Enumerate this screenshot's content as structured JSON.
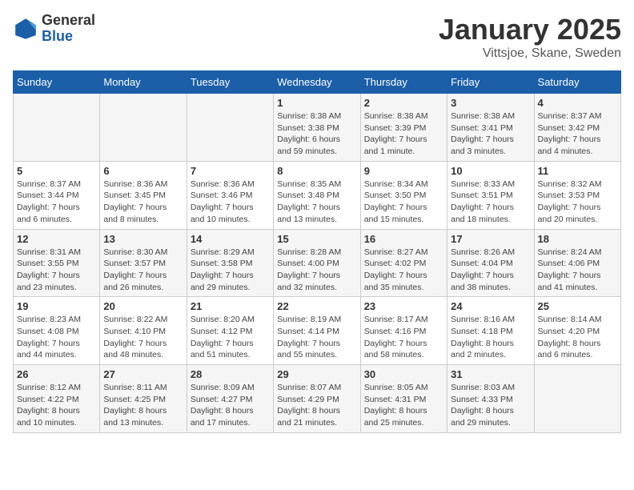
{
  "logo": {
    "general": "General",
    "blue": "Blue"
  },
  "title": "January 2025",
  "location": "Vittsjoe, Skane, Sweden",
  "weekdays": [
    "Sunday",
    "Monday",
    "Tuesday",
    "Wednesday",
    "Thursday",
    "Friday",
    "Saturday"
  ],
  "weeks": [
    [
      {
        "day": "",
        "info": ""
      },
      {
        "day": "",
        "info": ""
      },
      {
        "day": "",
        "info": ""
      },
      {
        "day": "1",
        "info": "Sunrise: 8:38 AM\nSunset: 3:38 PM\nDaylight: 6 hours\nand 59 minutes."
      },
      {
        "day": "2",
        "info": "Sunrise: 8:38 AM\nSunset: 3:39 PM\nDaylight: 7 hours\nand 1 minute."
      },
      {
        "day": "3",
        "info": "Sunrise: 8:38 AM\nSunset: 3:41 PM\nDaylight: 7 hours\nand 3 minutes."
      },
      {
        "day": "4",
        "info": "Sunrise: 8:37 AM\nSunset: 3:42 PM\nDaylight: 7 hours\nand 4 minutes."
      }
    ],
    [
      {
        "day": "5",
        "info": "Sunrise: 8:37 AM\nSunset: 3:44 PM\nDaylight: 7 hours\nand 6 minutes."
      },
      {
        "day": "6",
        "info": "Sunrise: 8:36 AM\nSunset: 3:45 PM\nDaylight: 7 hours\nand 8 minutes."
      },
      {
        "day": "7",
        "info": "Sunrise: 8:36 AM\nSunset: 3:46 PM\nDaylight: 7 hours\nand 10 minutes."
      },
      {
        "day": "8",
        "info": "Sunrise: 8:35 AM\nSunset: 3:48 PM\nDaylight: 7 hours\nand 13 minutes."
      },
      {
        "day": "9",
        "info": "Sunrise: 8:34 AM\nSunset: 3:50 PM\nDaylight: 7 hours\nand 15 minutes."
      },
      {
        "day": "10",
        "info": "Sunrise: 8:33 AM\nSunset: 3:51 PM\nDaylight: 7 hours\nand 18 minutes."
      },
      {
        "day": "11",
        "info": "Sunrise: 8:32 AM\nSunset: 3:53 PM\nDaylight: 7 hours\nand 20 minutes."
      }
    ],
    [
      {
        "day": "12",
        "info": "Sunrise: 8:31 AM\nSunset: 3:55 PM\nDaylight: 7 hours\nand 23 minutes."
      },
      {
        "day": "13",
        "info": "Sunrise: 8:30 AM\nSunset: 3:57 PM\nDaylight: 7 hours\nand 26 minutes."
      },
      {
        "day": "14",
        "info": "Sunrise: 8:29 AM\nSunset: 3:58 PM\nDaylight: 7 hours\nand 29 minutes."
      },
      {
        "day": "15",
        "info": "Sunrise: 8:28 AM\nSunset: 4:00 PM\nDaylight: 7 hours\nand 32 minutes."
      },
      {
        "day": "16",
        "info": "Sunrise: 8:27 AM\nSunset: 4:02 PM\nDaylight: 7 hours\nand 35 minutes."
      },
      {
        "day": "17",
        "info": "Sunrise: 8:26 AM\nSunset: 4:04 PM\nDaylight: 7 hours\nand 38 minutes."
      },
      {
        "day": "18",
        "info": "Sunrise: 8:24 AM\nSunset: 4:06 PM\nDaylight: 7 hours\nand 41 minutes."
      }
    ],
    [
      {
        "day": "19",
        "info": "Sunrise: 8:23 AM\nSunset: 4:08 PM\nDaylight: 7 hours\nand 44 minutes."
      },
      {
        "day": "20",
        "info": "Sunrise: 8:22 AM\nSunset: 4:10 PM\nDaylight: 7 hours\nand 48 minutes."
      },
      {
        "day": "21",
        "info": "Sunrise: 8:20 AM\nSunset: 4:12 PM\nDaylight: 7 hours\nand 51 minutes."
      },
      {
        "day": "22",
        "info": "Sunrise: 8:19 AM\nSunset: 4:14 PM\nDaylight: 7 hours\nand 55 minutes."
      },
      {
        "day": "23",
        "info": "Sunrise: 8:17 AM\nSunset: 4:16 PM\nDaylight: 7 hours\nand 58 minutes."
      },
      {
        "day": "24",
        "info": "Sunrise: 8:16 AM\nSunset: 4:18 PM\nDaylight: 8 hours\nand 2 minutes."
      },
      {
        "day": "25",
        "info": "Sunrise: 8:14 AM\nSunset: 4:20 PM\nDaylight: 8 hours\nand 6 minutes."
      }
    ],
    [
      {
        "day": "26",
        "info": "Sunrise: 8:12 AM\nSunset: 4:22 PM\nDaylight: 8 hours\nand 10 minutes."
      },
      {
        "day": "27",
        "info": "Sunrise: 8:11 AM\nSunset: 4:25 PM\nDaylight: 8 hours\nand 13 minutes."
      },
      {
        "day": "28",
        "info": "Sunrise: 8:09 AM\nSunset: 4:27 PM\nDaylight: 8 hours\nand 17 minutes."
      },
      {
        "day": "29",
        "info": "Sunrise: 8:07 AM\nSunset: 4:29 PM\nDaylight: 8 hours\nand 21 minutes."
      },
      {
        "day": "30",
        "info": "Sunrise: 8:05 AM\nSunset: 4:31 PM\nDaylight: 8 hours\nand 25 minutes."
      },
      {
        "day": "31",
        "info": "Sunrise: 8:03 AM\nSunset: 4:33 PM\nDaylight: 8 hours\nand 29 minutes."
      },
      {
        "day": "",
        "info": ""
      }
    ]
  ]
}
